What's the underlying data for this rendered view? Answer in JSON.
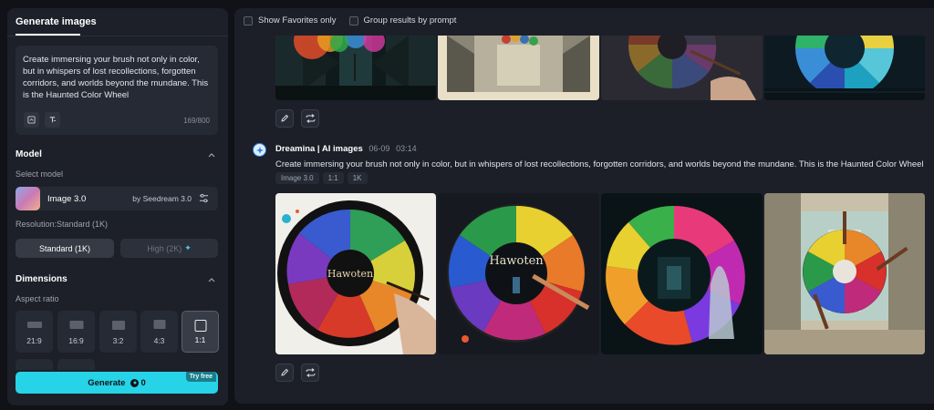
{
  "left_panel": {
    "tab": "Generate images",
    "prompt": {
      "text": "Create immersing your brush not only in color, but in whispers of lost recollections, forgotten corridors, and worlds beyond the mundane. This is the Haunted Color Wheel",
      "counter": "169/800"
    },
    "model_section": {
      "title": "Model",
      "select_label": "Select model",
      "model_name": "Image 3.0",
      "model_by": "by Seedream 3.0"
    },
    "resolution": {
      "label": "Resolution:Standard (1K)",
      "standard": "Standard (1K)",
      "high": "High (2K)"
    },
    "dimensions": {
      "title": "Dimensions",
      "aspect_label": "Aspect ratio",
      "ratios": [
        "21:9",
        "16:9",
        "3:2",
        "4:3",
        "1:1"
      ],
      "selected": "1:1"
    },
    "generate": {
      "label": "Generate",
      "credits": "0",
      "try_free": "Try free"
    }
  },
  "main": {
    "filters": {
      "favorites": "Show Favorites only",
      "group": "Group results by prompt"
    },
    "group": {
      "author": "Dreamina | AI images",
      "date": "06-09",
      "time": "03:14",
      "prompt": "Create immersing your brush not only in color, but in whispers of lost recollections, forgotten corridors, and worlds beyond the mundane. This is the Haunted Color Wheel",
      "tags": [
        "Image 3.0",
        "1:1",
        "1K"
      ]
    },
    "image_titles": [
      "Hawoten",
      "Hawoten"
    ]
  },
  "colors": {
    "accent": "#27d3e6",
    "panel": "#1d2029",
    "background": "#101218"
  }
}
